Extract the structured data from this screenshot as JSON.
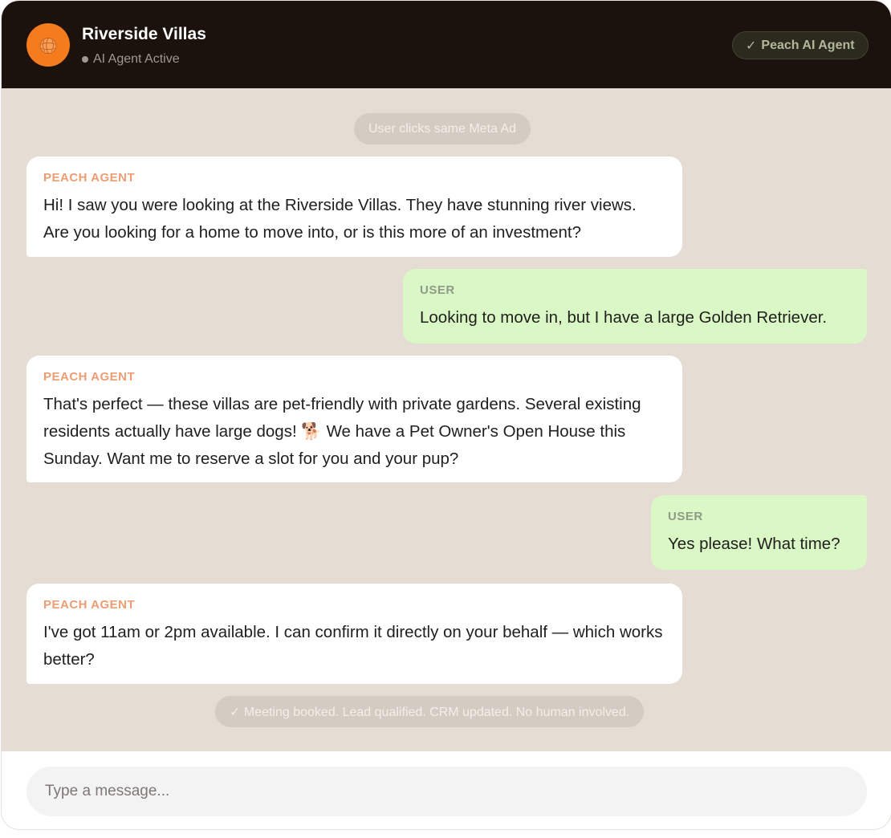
{
  "header": {
    "title": "Riverside Villas",
    "status": "AI Agent Active",
    "badge_check": "✓",
    "badge_label": "Peach AI Agent"
  },
  "chat": {
    "top_pill": "User clicks same Meta Ad",
    "messages": [
      {
        "role": "agent",
        "sender": "PEACH AGENT",
        "text": "Hi! I saw you were looking at the Riverside Villas. They have stunning river views. Are you looking for a home to move into, or is this more of an investment?"
      },
      {
        "role": "user",
        "sender": "USER",
        "text": "Looking to move in, but I have a large Golden Retriever."
      },
      {
        "role": "agent",
        "sender": "PEACH AGENT",
        "text": "That's perfect — these villas are pet-friendly with private gardens. Several existing residents actually have large dogs! 🐕 We have a Pet Owner's Open House this Sunday. Want me to reserve a slot for you and your pup?"
      },
      {
        "role": "user",
        "sender": "USER",
        "text": "Yes please! What time?"
      },
      {
        "role": "agent",
        "sender": "PEACH AGENT",
        "text": "I've got 11am or 2pm available. I can confirm it directly on your behalf — which works better?"
      }
    ],
    "bottom_pill": "✓ Meeting booked. Lead qualified. CRM updated. No human involved."
  },
  "composer": {
    "placeholder": "Type a message..."
  },
  "colors": {
    "header_bg": "#1b120d",
    "chat_bg": "#e5dcd3",
    "accent_orange": "#f47c1c",
    "agent_label": "#ed9d73",
    "user_bubble": "#daf8c6"
  },
  "icons": {
    "avatar": "peach-icon",
    "status": "status-dot-icon"
  }
}
